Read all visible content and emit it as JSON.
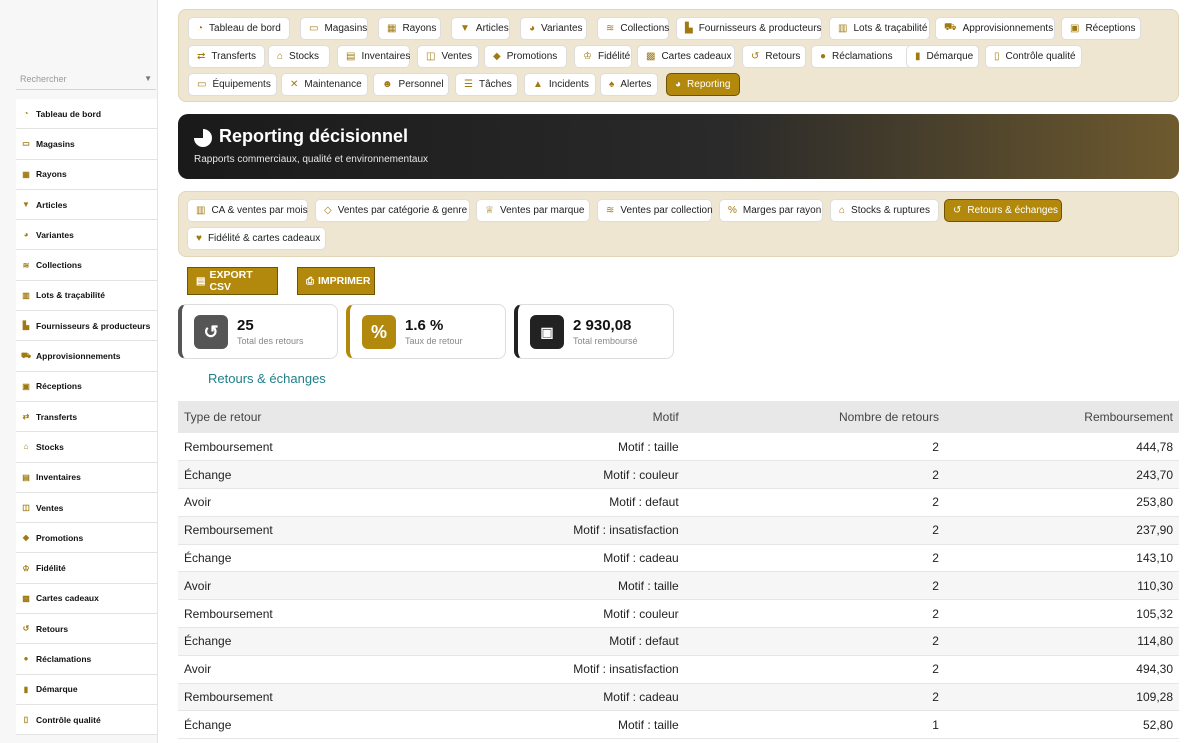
{
  "sidebar": {
    "search_placeholder": "Rechercher",
    "items": [
      {
        "label": "Tableau de bord",
        "icon": "dashboard-icon"
      },
      {
        "label": "Magasins",
        "icon": "store-icon"
      },
      {
        "label": "Rayons",
        "icon": "grid-icon"
      },
      {
        "label": "Articles",
        "icon": "shirt-icon"
      },
      {
        "label": "Variantes",
        "icon": "palette-icon"
      },
      {
        "label": "Collections",
        "icon": "layers-icon"
      },
      {
        "label": "Lots & traçabilité",
        "icon": "chart-icon"
      },
      {
        "label": "Fournisseurs & producteurs",
        "icon": "factory-icon"
      },
      {
        "label": "Approvisionnements",
        "icon": "truck-icon"
      },
      {
        "label": "Réceptions",
        "icon": "box-icon"
      },
      {
        "label": "Transferts",
        "icon": "transfer-icon"
      },
      {
        "label": "Stocks",
        "icon": "warehouse-icon"
      },
      {
        "label": "Inventaires",
        "icon": "clipboard-icon"
      },
      {
        "label": "Ventes",
        "icon": "cart-icon"
      },
      {
        "label": "Promotions",
        "icon": "tag-icon"
      },
      {
        "label": "Fidélité",
        "icon": "medal-icon"
      },
      {
        "label": "Cartes cadeaux",
        "icon": "gift-icon"
      },
      {
        "label": "Retours",
        "icon": "undo-icon"
      },
      {
        "label": "Réclamations",
        "icon": "comment-icon"
      },
      {
        "label": "Démarque",
        "icon": "trash-icon"
      },
      {
        "label": "Contrôle qualité",
        "icon": "check-icon"
      }
    ]
  },
  "nav": {
    "chips": [
      {
        "label": "Tableau de bord",
        "icon": "dashboard-icon"
      },
      {
        "label": "Magasins",
        "icon": "store-icon"
      },
      {
        "label": "Rayons",
        "icon": "grid-icon"
      },
      {
        "label": "Articles",
        "icon": "shirt-icon"
      },
      {
        "label": "Variantes",
        "icon": "palette-icon"
      },
      {
        "label": "Collections",
        "icon": "layers-icon"
      },
      {
        "label": "Fournisseurs & producteurs",
        "icon": "factory-icon"
      },
      {
        "label": "Lots & traçabilité",
        "icon": "chart-icon"
      },
      {
        "label": "Approvisionnements",
        "icon": "truck-icon"
      },
      {
        "label": "Réceptions",
        "icon": "box-icon"
      },
      {
        "label": "Transferts",
        "icon": "transfer-icon"
      },
      {
        "label": "Stocks",
        "icon": "warehouse-icon"
      },
      {
        "label": "Inventaires",
        "icon": "clipboard-icon"
      },
      {
        "label": "Ventes",
        "icon": "cart-icon"
      },
      {
        "label": "Promotions",
        "icon": "tag-icon"
      },
      {
        "label": "Fidélité",
        "icon": "medal-icon"
      },
      {
        "label": "Cartes cadeaux",
        "icon": "gift-icon"
      },
      {
        "label": "Retours",
        "icon": "undo-icon"
      },
      {
        "label": "Réclamations",
        "icon": "comment-icon"
      },
      {
        "label": "Démarque",
        "icon": "trash-icon"
      },
      {
        "label": "Contrôle qualité",
        "icon": "check-icon"
      },
      {
        "label": "Équipements",
        "icon": "monitor-icon"
      },
      {
        "label": "Maintenance",
        "icon": "tools-icon"
      },
      {
        "label": "Personnel",
        "icon": "users-icon"
      },
      {
        "label": "Tâches",
        "icon": "list-icon"
      },
      {
        "label": "Incidents",
        "icon": "warning-icon"
      },
      {
        "label": "Alertes",
        "icon": "bell-icon"
      },
      {
        "label": "Reporting",
        "icon": "pie-chart-icon",
        "active": true
      }
    ]
  },
  "hero": {
    "title": "Reporting décisionnel",
    "subtitle": "Rapports commerciaux, qualité et environnementaux"
  },
  "report_tabs": [
    {
      "label": "CA & ventes par mois",
      "icon": "chart-icon"
    },
    {
      "label": "Ventes par catégorie & genre",
      "icon": "tags-icon"
    },
    {
      "label": "Ventes par marque",
      "icon": "crown-icon"
    },
    {
      "label": "Ventes par collection",
      "icon": "layers-icon"
    },
    {
      "label": "Marges par rayon",
      "icon": "percent-icon"
    },
    {
      "label": "Stocks & ruptures",
      "icon": "warehouse-icon"
    },
    {
      "label": "Retours & échanges",
      "icon": "undo-icon",
      "active": true
    },
    {
      "label": "Fidélité & cartes cadeaux",
      "icon": "heart-icon"
    }
  ],
  "actions": {
    "export_label": "EXPORT CSV",
    "print_label": "IMPRIMER"
  },
  "kpis": [
    {
      "value": "25",
      "label": "Total des retours",
      "icon": "undo-icon",
      "color": "#555555"
    },
    {
      "value": "1.6 %",
      "label": "Taux de retour",
      "icon": "percent-icon",
      "color": "#b3890d"
    },
    {
      "value": "2 930,08",
      "label": "Total remboursé",
      "icon": "banknote-icon",
      "color": "#222222"
    }
  ],
  "section_title": "Retours & échanges",
  "table": {
    "headers": [
      "Type de retour",
      "Motif",
      "Nombre de retours",
      "Remboursement"
    ],
    "rows": [
      [
        "Remboursement",
        "Motif : taille",
        "2",
        "444,78"
      ],
      [
        "Échange",
        "Motif : couleur",
        "2",
        "243,70"
      ],
      [
        "Avoir",
        "Motif : defaut",
        "2",
        "253,80"
      ],
      [
        "Remboursement",
        "Motif : insatisfaction",
        "2",
        "237,90"
      ],
      [
        "Échange",
        "Motif : cadeau",
        "2",
        "143,10"
      ],
      [
        "Avoir",
        "Motif : taille",
        "2",
        "110,30"
      ],
      [
        "Remboursement",
        "Motif : couleur",
        "2",
        "105,32"
      ],
      [
        "Échange",
        "Motif : defaut",
        "2",
        "114,80"
      ],
      [
        "Avoir",
        "Motif : insatisfaction",
        "2",
        "494,30"
      ],
      [
        "Remboursement",
        "Motif : cadeau",
        "2",
        "109,28"
      ],
      [
        "Échange",
        "Motif : taille",
        "1",
        "52,80"
      ]
    ]
  },
  "colors": {
    "accent": "#b3890d",
    "panel": "#efe6d2",
    "section_title": "#1f7f88"
  }
}
